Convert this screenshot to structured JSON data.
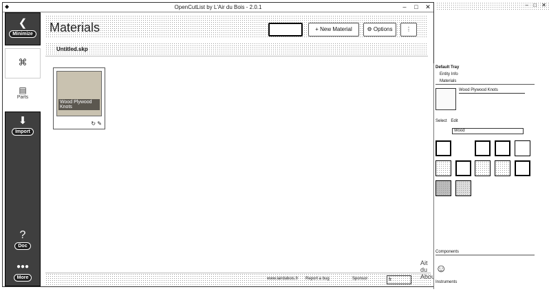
{
  "window": {
    "title": "OpenCutList by L'Air du Bois - 2.0.1",
    "controls": [
      "–",
      "□",
      "✕"
    ]
  },
  "sidebar": {
    "minimize_label": "Minimize",
    "tab_cutlist_icon": "cutlist-icon",
    "tab_parts_label": "Parts",
    "import_label": "Import",
    "doc_label": "Doc",
    "more_label": "More"
  },
  "header": {
    "title": "Materials",
    "new_material_label": "+ New Material",
    "options_label": "⚙ Options",
    "menu_label": "⋮"
  },
  "file": {
    "name": "Untitled.skp"
  },
  "materials": [
    {
      "name": "Wood Plywood Knots",
      "color": "#c9c2b0"
    }
  ],
  "footer": {
    "website": "www.lairdubois.fr",
    "report_bug": "Report a bug",
    "sponsor": "Sponsor",
    "language": "fr",
    "about_lines": [
      "Ait",
      "du",
      "About"
    ]
  },
  "tray": {
    "title": "Default Tray",
    "entity_info": "Entity Info",
    "materials": "Materials",
    "material_name": "Wood Plywood Knots",
    "select_label": "Select",
    "edit_label": "Edit",
    "library": "Wood",
    "components": "Components",
    "instruments": "Instruments"
  }
}
